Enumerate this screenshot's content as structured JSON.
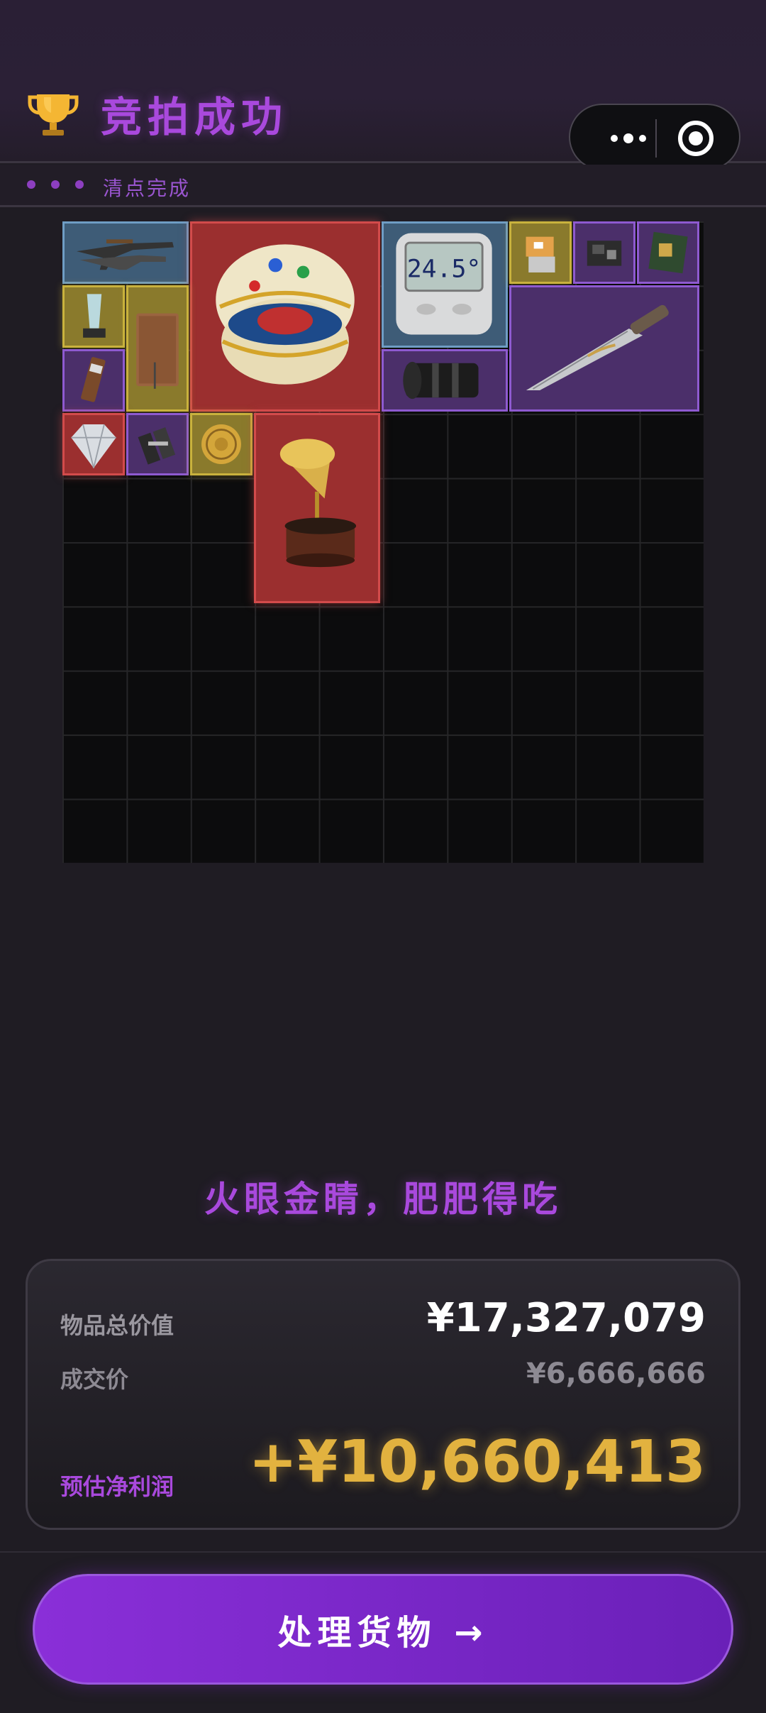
{
  "header": {
    "title": "竞拍成功",
    "trophy_icon": "trophy-icon",
    "capsule": {
      "more_icon": "more-dots-icon",
      "close_icon": "target-close-icon"
    }
  },
  "status": {
    "label": "清点完成"
  },
  "inventory": {
    "items": [
      {
        "name": "assault-rifles",
        "rarity": "blue"
      },
      {
        "name": "jeweled-egg",
        "rarity": "red"
      },
      {
        "name": "thermometer",
        "rarity": "blue",
        "display_text": "24.5°"
      },
      {
        "name": "supply-kit",
        "rarity": "gold"
      },
      {
        "name": "circuit-module",
        "rarity": "purple"
      },
      {
        "name": "processor-board",
        "rarity": "purple"
      },
      {
        "name": "crystal-award",
        "rarity": "gold"
      },
      {
        "name": "leather-notebook",
        "rarity": "gold"
      },
      {
        "name": "combat-knife",
        "rarity": "purple"
      },
      {
        "name": "camera-lens",
        "rarity": "purple"
      },
      {
        "name": "energy-bar",
        "rarity": "purple"
      },
      {
        "name": "diamond",
        "rarity": "red"
      },
      {
        "name": "mechanical-part",
        "rarity": "purple"
      },
      {
        "name": "gold-coin",
        "rarity": "gold"
      },
      {
        "name": "gramophone",
        "rarity": "red"
      }
    ],
    "colors": {
      "red": "#9b2f2f",
      "blue": "#3e5c77",
      "gold": "#8a7a2c",
      "purple": "#4b2f6a"
    }
  },
  "slogan": "火眼金睛，肥肥得吃",
  "summary": {
    "total_label": "物品总价值",
    "total_value": "¥17,327,079",
    "deal_label": "成交价",
    "deal_value": "¥6,666,666",
    "profit_label": "预估净利润",
    "profit_value": "+¥10,660,413"
  },
  "cta": {
    "label": "处理货物 →"
  },
  "theme": {
    "accent": "#a949dd",
    "profit": "#e2b23f"
  }
}
